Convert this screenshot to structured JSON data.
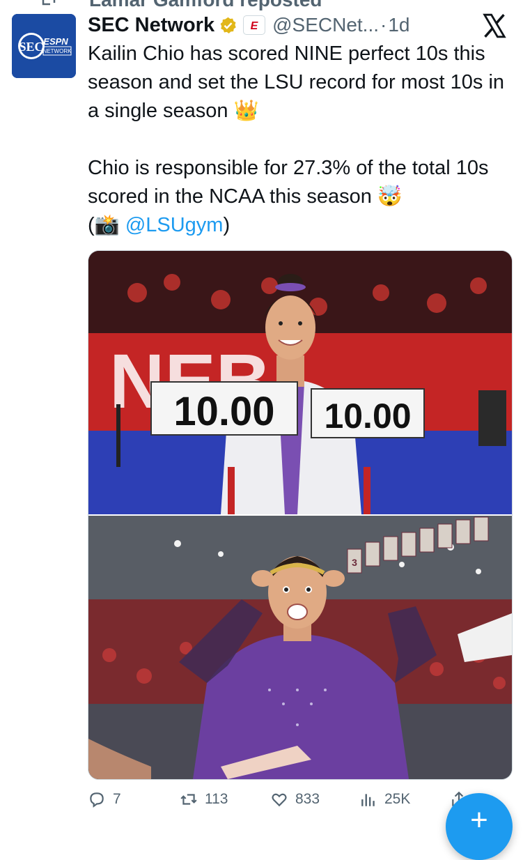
{
  "repost": {
    "text": "Lamar Gamford reposted"
  },
  "author": {
    "name": "SEC Network",
    "handle": "@SECNet...",
    "time": "1d",
    "separator": "·",
    "avatar_text": {
      "sec": "SEC",
      "espn": "ESPN",
      "network": "NETWORK"
    },
    "badge_letter": "E"
  },
  "tweet": {
    "line1": "Kailin Chio has scored NINE perfect 10s this season and set the LSU record for most 10s in a single season 👑",
    "line2": "Chio is responsible for 27.3% of the total 10s scored in the NCAA this season 🤯",
    "photo_open": "(📸 ",
    "mention": "@LSUgym",
    "photo_close": ")"
  },
  "media": {
    "top_scores": {
      "left": "10.00",
      "right": "10.00"
    },
    "banner_text": "NEB",
    "bottom_banners": "3"
  },
  "actions": {
    "replies": "7",
    "reposts": "113",
    "likes": "833",
    "views": "25K"
  },
  "fab": {
    "label": "+"
  },
  "colors": {
    "accent": "#1d9bf0",
    "muted": "#536471",
    "lsu_purple": "#6b3fa0"
  },
  "icons": [
    "repost-icon",
    "verified-icon",
    "x-logo-icon",
    "reply-icon",
    "like-icon",
    "views-icon",
    "share-icon"
  ]
}
